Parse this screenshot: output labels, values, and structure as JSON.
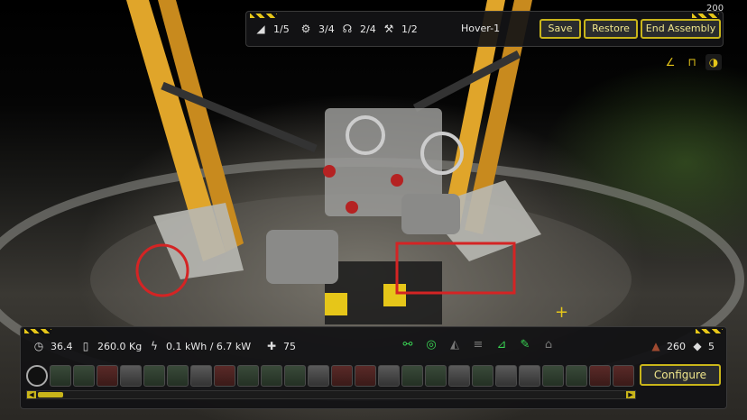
{
  "corner_count": "200",
  "top_bar": {
    "stats": [
      {
        "icon": "wing-icon",
        "value": "1/5"
      },
      {
        "icon": "gear-icon",
        "value": "3/4"
      },
      {
        "icon": "controller-icon",
        "value": "2/4"
      },
      {
        "icon": "wrench-icon",
        "value": "1/2"
      }
    ],
    "title": "Hover-1",
    "save_label": "Save",
    "restore_label": "Restore",
    "end_label": "End Assembly"
  },
  "tools": [
    "angle-icon",
    "pin-icon",
    "crash-icon"
  ],
  "bottom": {
    "time": "36.4",
    "mass": "260.0 Kg",
    "energy": "0.1 kWh / 6.7 kW",
    "health": "75",
    "green_icons": [
      "joint-icon",
      "thruster-icon",
      "wing-icon",
      "stack-icon",
      "crane-icon",
      "pen-icon",
      "vehicle-icon"
    ],
    "res1": "260",
    "res2": "5",
    "configure_label": "Configure"
  }
}
